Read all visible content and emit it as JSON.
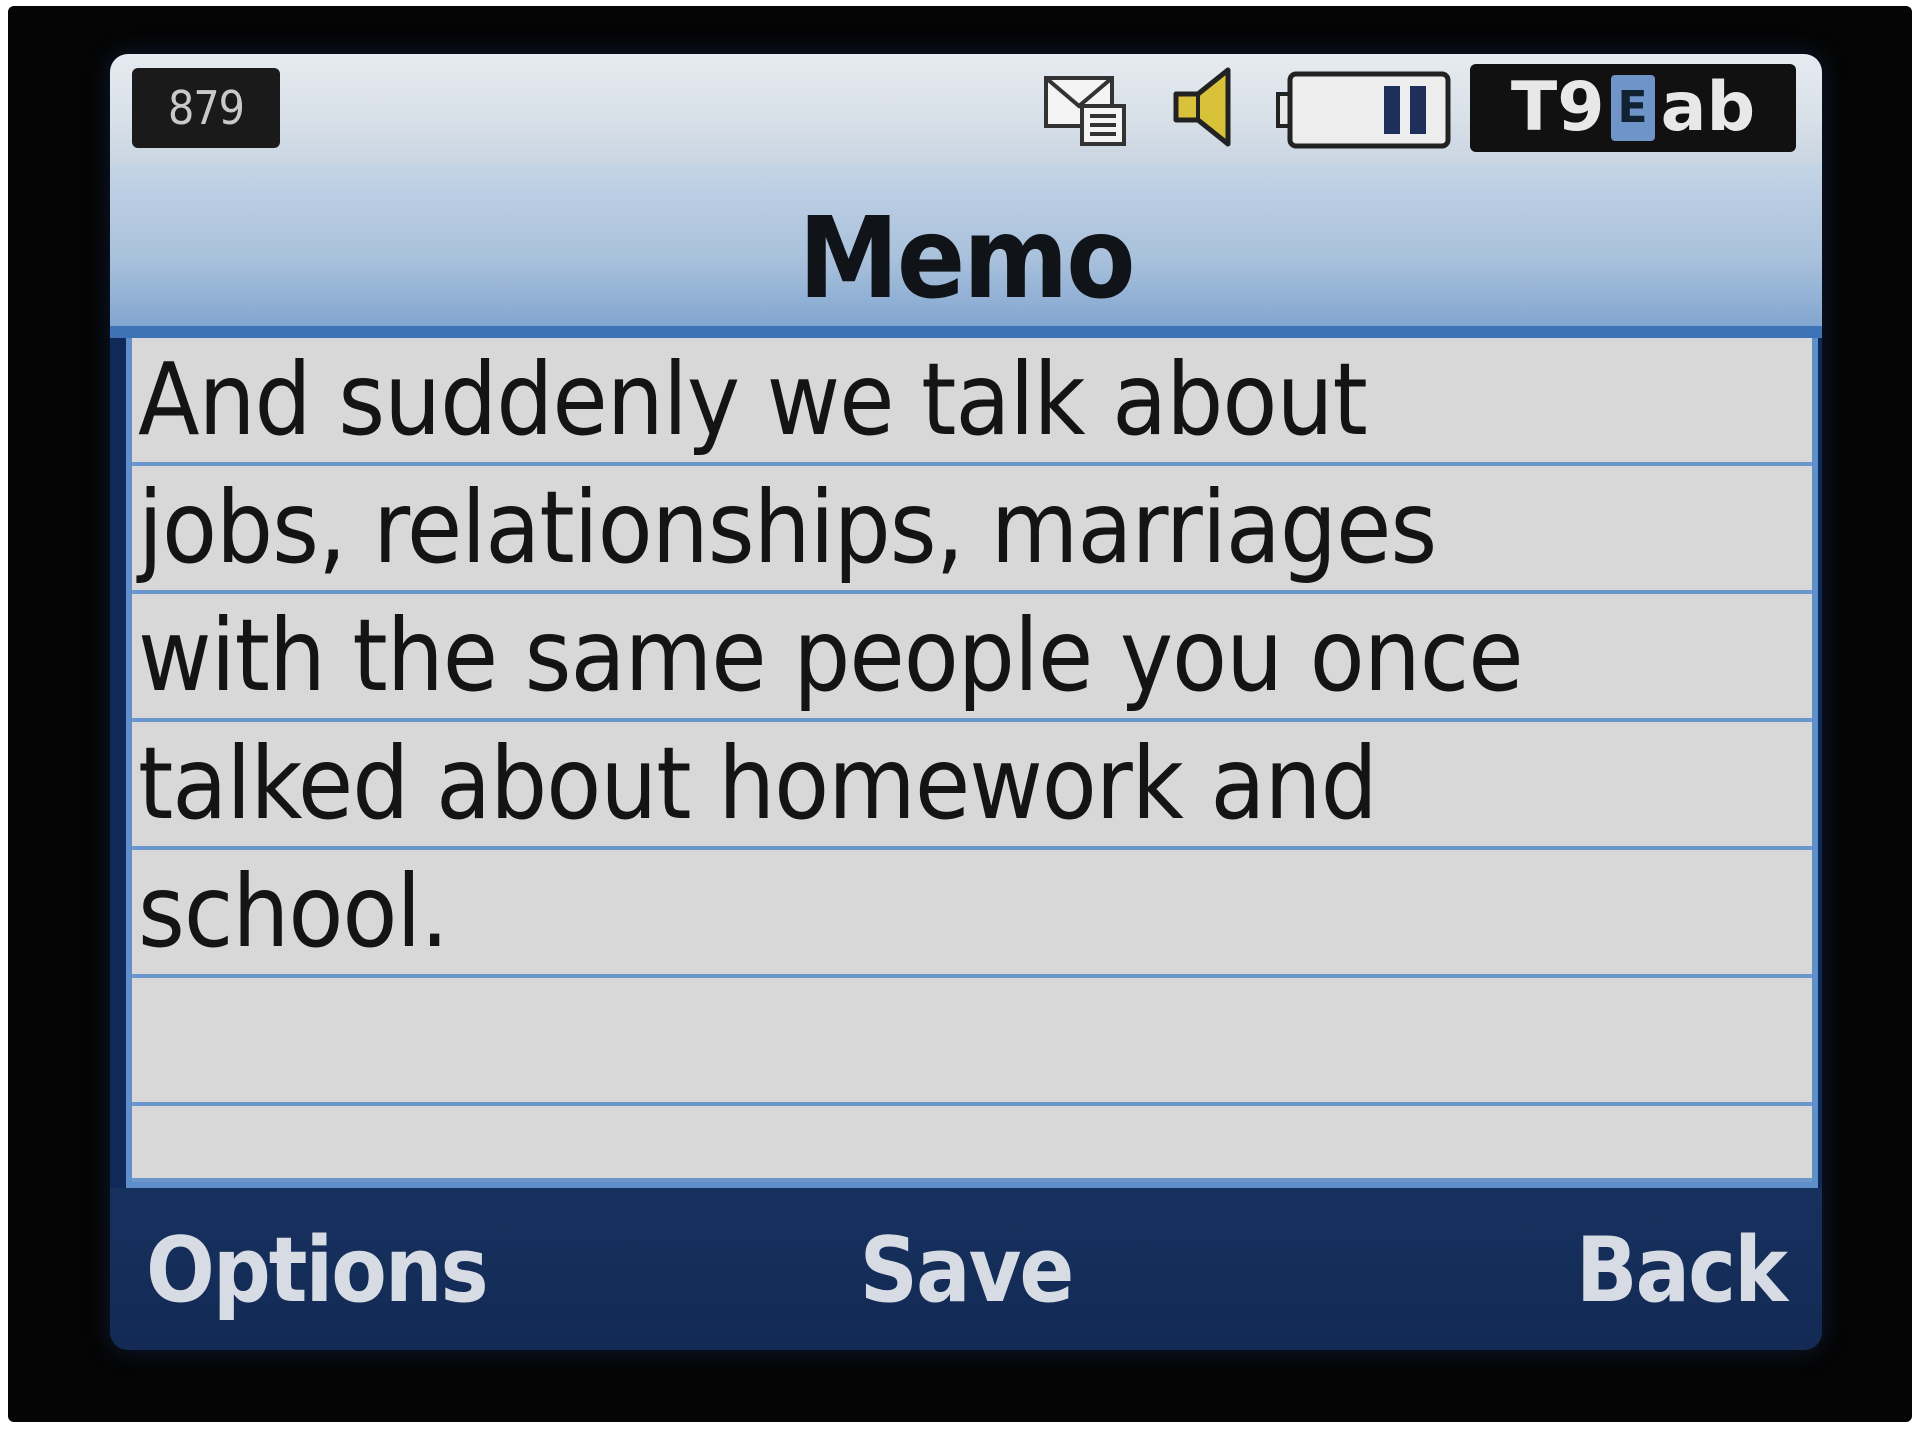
{
  "status_bar": {
    "counter": "879",
    "icons": [
      "message-icon",
      "speaker-icon",
      "battery-icon"
    ],
    "input_mode": {
      "t9": "T9",
      "language": "E",
      "case": "ab"
    }
  },
  "header": {
    "title": "Memo"
  },
  "memo": {
    "lines": [
      "And suddenly we talk about",
      "jobs, relationships, marriages",
      "with the same people you once",
      "talked about homework and",
      "school.",
      "",
      ""
    ]
  },
  "softkeys": {
    "left": "Options",
    "center": "Save",
    "right": "Back"
  },
  "colors": {
    "screen_bg": "#0f2a58",
    "title_gradient_top": "#c4d4e6",
    "title_gradient_bottom": "#7ea3cf",
    "editor_bg": "#d8d8d8",
    "rule_line": "#6b96c9",
    "softkey_text": "#d7dbe3"
  }
}
